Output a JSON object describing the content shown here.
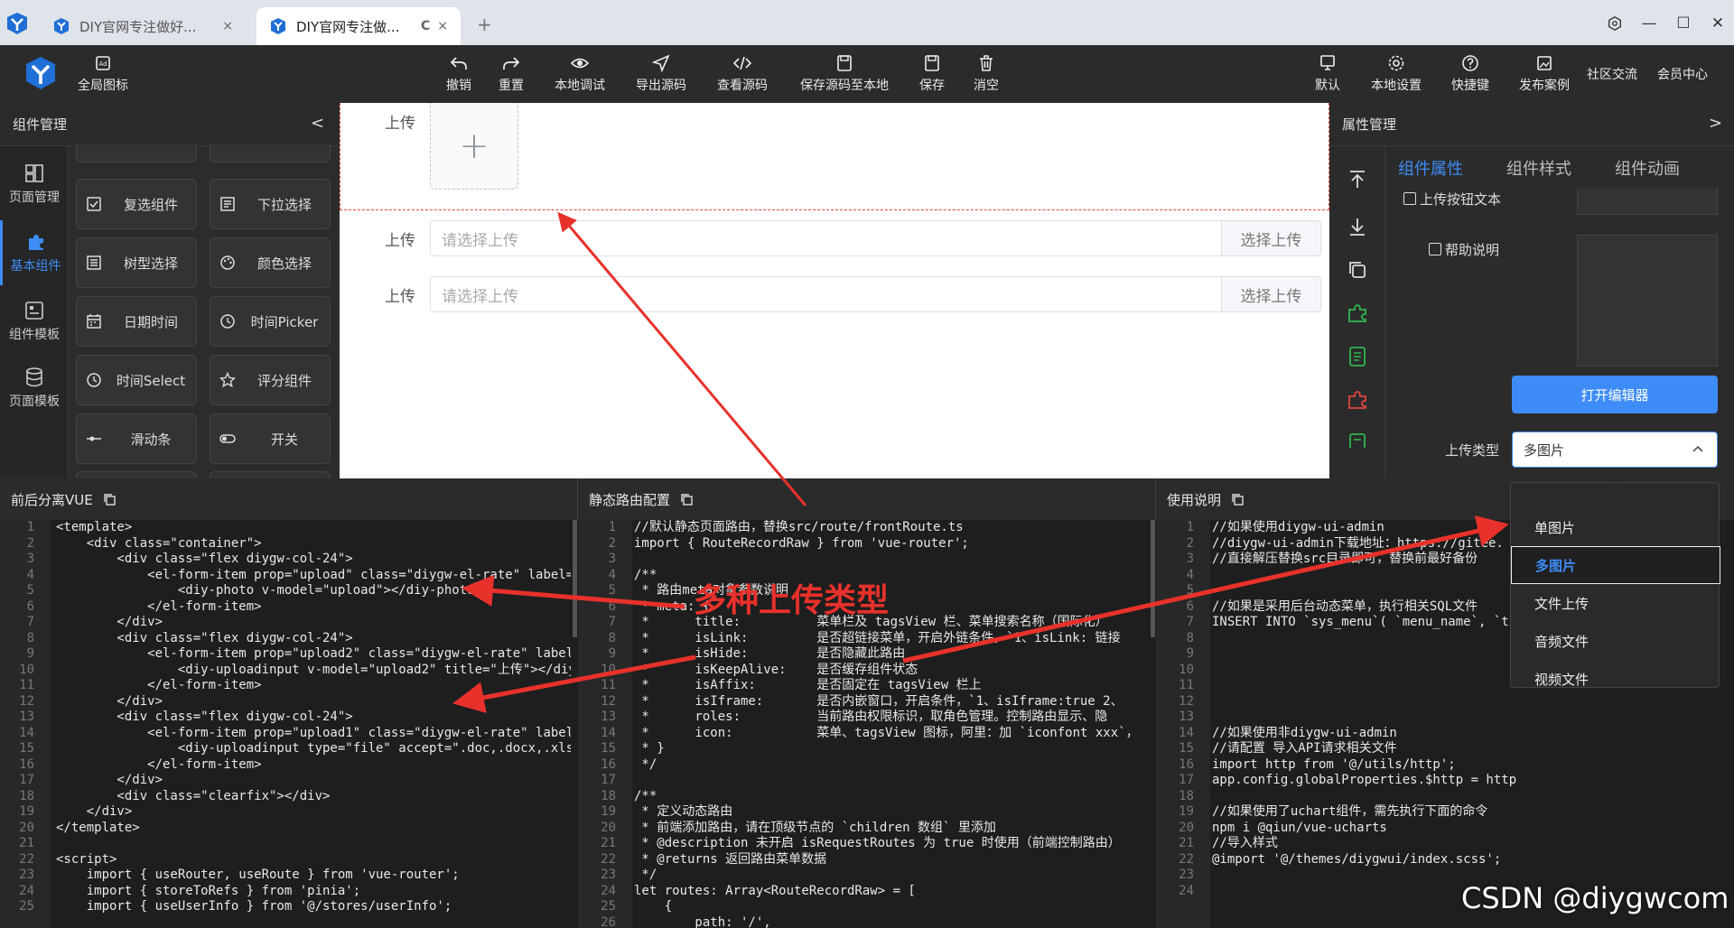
{
  "browser": {
    "tabs": [
      {
        "title": "DIY官网专注做好...",
        "close": "×"
      },
      {
        "title": "DIY官网专注做...",
        "reload": "C",
        "close": "×"
      }
    ],
    "new_tab": "+",
    "win_min": "—",
    "win_max": "☐",
    "win_close": "✕"
  },
  "toolbar": {
    "global_icon_label": "全局图标",
    "center": [
      {
        "label": "撤销",
        "icon": "undo-icon"
      },
      {
        "label": "重置",
        "icon": "redo-icon"
      },
      {
        "label": "本地调试",
        "icon": "eye-icon"
      },
      {
        "label": "导出源码",
        "icon": "send-icon"
      },
      {
        "label": "查看源码",
        "icon": "code-icon"
      },
      {
        "label": "保存源码至本地",
        "icon": "save-icon"
      },
      {
        "label": "保存",
        "icon": "save-icon"
      },
      {
        "label": "消空",
        "icon": "trash-icon"
      }
    ],
    "right": [
      {
        "label": "默认",
        "icon": "monitor-icon"
      },
      {
        "label": "本地设置",
        "icon": "gear-icon"
      },
      {
        "label": "快捷键",
        "icon": "help-icon"
      },
      {
        "label": "发布案例",
        "icon": "image-icon"
      },
      {
        "label": "社区交流"
      },
      {
        "label": "会员中心"
      }
    ]
  },
  "left_panel": {
    "title": "组件管理",
    "collapse": "<",
    "nav": [
      {
        "label": "页面管理"
      },
      {
        "label": "基本组件"
      },
      {
        "label": "组件模板"
      },
      {
        "label": "页面模板"
      }
    ],
    "components": [
      {
        "label": "复选组件",
        "icon": "checkbox-icon"
      },
      {
        "label": "下拉选择",
        "icon": "select-icon"
      },
      {
        "label": "树型选择",
        "icon": "tree-icon"
      },
      {
        "label": "颜色选择",
        "icon": "palette-icon"
      },
      {
        "label": "日期时间",
        "icon": "calendar-icon"
      },
      {
        "label": "时间Picker",
        "icon": "clock-icon"
      },
      {
        "label": "时间Select",
        "icon": "clock-icon"
      },
      {
        "label": "评分组件",
        "icon": "star-icon"
      },
      {
        "label": "滑动条",
        "icon": "slider-icon"
      },
      {
        "label": "开关",
        "icon": "toggle-icon"
      }
    ]
  },
  "canvas": {
    "rows": [
      {
        "label": "上传",
        "type": "photo"
      },
      {
        "label": "上传",
        "placeholder": "请选择上传",
        "button": "选择上传"
      },
      {
        "label": "上传",
        "placeholder": "请选择上传",
        "button": "选择上传"
      }
    ],
    "plus": "+"
  },
  "right_panel": {
    "title": "属性管理",
    "expand": ">",
    "tabs": [
      "组件属性",
      "组件样式",
      "组件动画"
    ],
    "fields": {
      "button_text_label": "上传按钮文本",
      "help_label": "帮助说明",
      "open_editor": "打开编辑器",
      "upload_type_label": "上传类型",
      "upload_type_value": "多图片"
    }
  },
  "dropdown": {
    "options": [
      "单图片",
      "多图片",
      "文件上传",
      "音频文件",
      "视频文件"
    ],
    "selected": "多图片"
  },
  "panes": [
    {
      "title": "前后分离VUE",
      "lines": [
        "<template>",
        "    <div class=\"container\">",
        "        <div class=\"flex diygw-col-24\">",
        "            <el-form-item prop=\"upload\" class=\"diygw-el-rate\" label=\"",
        "                <diy-photo v-model=\"upload\"></diy-photo>",
        "            </el-form-item>",
        "        </div>",
        "        <div class=\"flex diygw-col-24\">",
        "            <el-form-item prop=\"upload2\" class=\"diygw-el-rate\" label=\"",
        "                <diy-uploadinput v-model=\"upload2\" title=\"上传\"></diy",
        "            </el-form-item>",
        "        </div>",
        "        <div class=\"flex diygw-col-24\">",
        "            <el-form-item prop=\"upload1\" class=\"diygw-el-rate\" label=\"",
        "                <diy-uploadinput type=\"file\" accept=\".doc,.docx,.xls,",
        "            </el-form-item>",
        "        </div>",
        "        <div class=\"clearfix\"></div>",
        "    </div>",
        "</template>",
        "",
        "<script>",
        "    import { useRouter, useRoute } from 'vue-router';",
        "    import { storeToRefs } from 'pinia';",
        "    import { useUserInfo } from '@/stores/userInfo';"
      ]
    },
    {
      "title": "静态路由配置",
      "lines": [
        "//默认静态页面路由，替换src/route/frontRoute.ts",
        "import { RouteRecordRaw } from 'vue-router';",
        "",
        "/**",
        " * 路由meta对象参数说明",
        " * meta: {",
        " *      title:          菜单栏及 tagsView 栏、菜单搜索名称（国际化）",
        " *      isLink:         是否超链接菜单，开启外链条件，`1、isLink: 链接",
        " *      isHide:         是否隐藏此路由",
        " *      isKeepAlive:    是否缓存组件状态",
        " *      isAffix:        是否固定在 tagsView 栏上",
        " *      isIframe:       是否内嵌窗口，开启条件，`1、isIframe:true 2、",
        " *      roles:          当前路由权限标识，取角色管理。控制路由显示、隐",
        " *      icon:           菜单、tagsView 图标，阿里：加 `iconfont xxx`，",
        " * }",
        " */",
        "",
        "/**",
        " * 定义动态路由",
        " * 前端添加路由，请在顶级节点的 `children 数组` 里添加",
        " * @description 未开启 isRequestRoutes 为 true 时使用（前端控制路由）",
        " * @returns 返回路由菜单数据",
        " */",
        "let routes: Array<RouteRecordRaw> = [",
        "    {",
        "        path: '/',"
      ]
    },
    {
      "title": "使用说明",
      "lines": [
        "//如果使用diygw-ui-admin",
        "//diygw-ui-admin下载地址：https://gitee.",
        "//直接解压替换src目录即可，替换前最好备份",
        "",
        "",
        "//如果是采用后台动态菜单，执行相关SQL文件",
        "INSERT INTO `sys_menu`( `menu_name`, `ti",
        "",
        "",
        "",
        "",
        "",
        "",
        "//如果使用非diygw-ui-admin",
        "//请配置 导入API请求相关文件",
        "import http from '@/utils/http';",
        "app.config.globalProperties.$http = http",
        "",
        "//如果使用了uchart组件，需先执行下面的命令",
        "npm i @qiun/vue-ucharts",
        "//导入样式",
        "@import '@/themes/diygwui/index.scss';",
        "",
        ""
      ]
    }
  ],
  "annotation": "多种上传类型",
  "watermark": "CSDN @diygwcom"
}
